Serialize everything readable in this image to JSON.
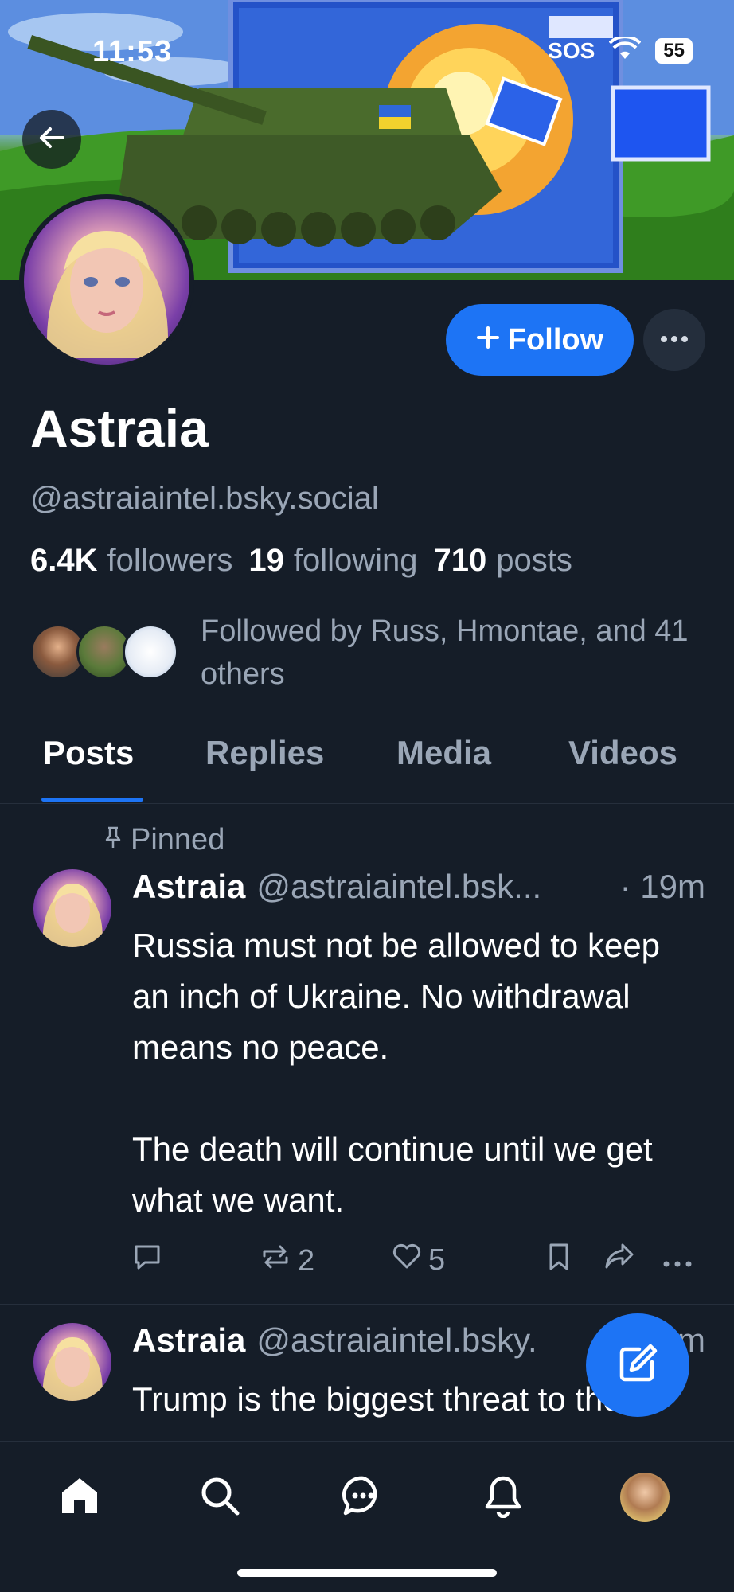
{
  "status_bar": {
    "time": "11:53",
    "sos": "SOS",
    "battery": "55"
  },
  "profile": {
    "display_name": "Astraia",
    "handle": "@astraiaintel.bsky.social",
    "followers_count": "6.4K",
    "followers_label": "followers",
    "following_count": "19",
    "following_label": "following",
    "posts_count": "710",
    "posts_label": "posts",
    "followed_by": "Followed by Russ, Hmontae, and 41 others",
    "follow_label": "Follow"
  },
  "tabs": [
    {
      "label": "Posts",
      "active": true
    },
    {
      "label": "Replies",
      "active": false
    },
    {
      "label": "Media",
      "active": false
    },
    {
      "label": "Videos",
      "active": false
    }
  ],
  "posts": [
    {
      "pinned_label": "Pinned",
      "author": "Astraia",
      "handle": "@astraiaintel.bsk...",
      "time": "· 19m",
      "text": "Russia must not be allowed to keep an inch of Ukraine. No withdrawal means no peace.\n\nThe death will continue until we get what we want.",
      "reposts": "2",
      "likes": "5"
    },
    {
      "author": "Astraia",
      "handle": "@astraiaintel.bsky.",
      "time": "m",
      "text": "Trump is the biggest threat to the"
    }
  ],
  "icons": {
    "back": "arrow-left-icon",
    "more": "ellipsis-icon",
    "pin": "pin-icon",
    "reply": "comment-icon",
    "repost": "repost-icon",
    "like": "heart-icon",
    "bookmark": "bookmark-icon",
    "share": "share-icon",
    "compose": "compose-icon",
    "home": "home-icon",
    "search": "search-icon",
    "chat": "chat-icon",
    "notifications": "bell-icon"
  },
  "colors": {
    "accent": "#1d74f5",
    "background": "#151d28",
    "muted": "#9aa6b6"
  }
}
